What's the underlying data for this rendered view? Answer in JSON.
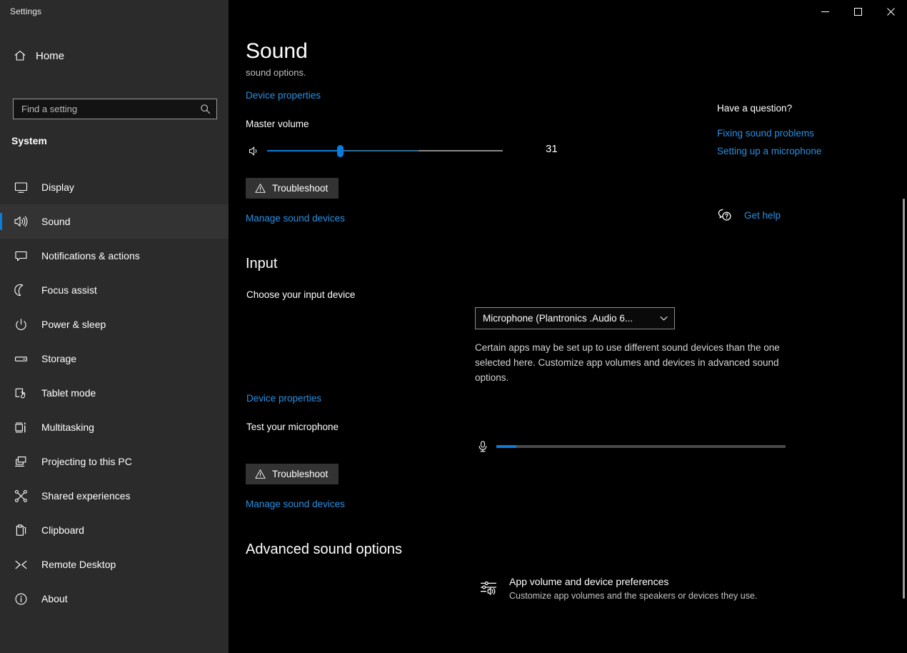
{
  "window": {
    "title": "Settings",
    "caption": {
      "minimize": "Minimize",
      "maximize": "Maximize",
      "close": "Close"
    }
  },
  "sidebar": {
    "home_label": "Home",
    "search": {
      "placeholder": "Find a setting",
      "value": ""
    },
    "section_title": "System",
    "items": [
      {
        "label": "Display",
        "icon": "monitor-icon",
        "selected": false
      },
      {
        "label": "Sound",
        "icon": "speaker-icon",
        "selected": true
      },
      {
        "label": "Notifications & actions",
        "icon": "notification-icon",
        "selected": false
      },
      {
        "label": "Focus assist",
        "icon": "moon-icon",
        "selected": false
      },
      {
        "label": "Power & sleep",
        "icon": "power-icon",
        "selected": false
      },
      {
        "label": "Storage",
        "icon": "drive-icon",
        "selected": false
      },
      {
        "label": "Tablet mode",
        "icon": "tablet-icon",
        "selected": false
      },
      {
        "label": "Multitasking",
        "icon": "multitasking-icon",
        "selected": false
      },
      {
        "label": "Projecting to this PC",
        "icon": "project-icon",
        "selected": false
      },
      {
        "label": "Shared experiences",
        "icon": "share-icon",
        "selected": false
      },
      {
        "label": "Clipboard",
        "icon": "clipboard-icon",
        "selected": false
      },
      {
        "label": "Remote Desktop",
        "icon": "remote-desktop-icon",
        "selected": false
      },
      {
        "label": "About",
        "icon": "info-icon",
        "selected": false
      }
    ]
  },
  "page": {
    "title": "Sound",
    "subtitle": "sound options.",
    "output": {
      "device_properties_link": "Device properties",
      "master_volume_label": "Master volume",
      "volume_value": "31",
      "volume_percent": 31,
      "troubleshoot_label": "Troubleshoot",
      "manage_devices_link": "Manage sound devices"
    },
    "input": {
      "heading": "Input",
      "choose_label": "Choose your input device",
      "device_value": "Microphone (Plantronics .Audio 6...",
      "note": "Certain apps may be set up to use different sound devices than the one selected here. Customize app volumes and devices in advanced sound options.",
      "device_properties_link": "Device properties",
      "test_label": "Test your microphone",
      "mic_level_percent": 7,
      "troubleshoot_label": "Troubleshoot",
      "manage_devices_link": "Manage sound devices"
    },
    "advanced": {
      "heading": "Advanced sound options",
      "item_title": "App volume and device preferences",
      "item_desc": "Customize app volumes and the speakers or devices they use.",
      "icon": "app-mixer-icon"
    }
  },
  "help": {
    "title": "Have a question?",
    "links": [
      "Fixing sound problems",
      "Setting up a microphone"
    ],
    "get_help_label": "Get help",
    "get_help_icon": "help-bubble-icon"
  },
  "colors": {
    "accent": "#0a7ddb",
    "link": "#2a8fe0",
    "sidebar_bg": "#2b2b2b",
    "content_bg": "#000000",
    "button_bg": "#333333"
  }
}
